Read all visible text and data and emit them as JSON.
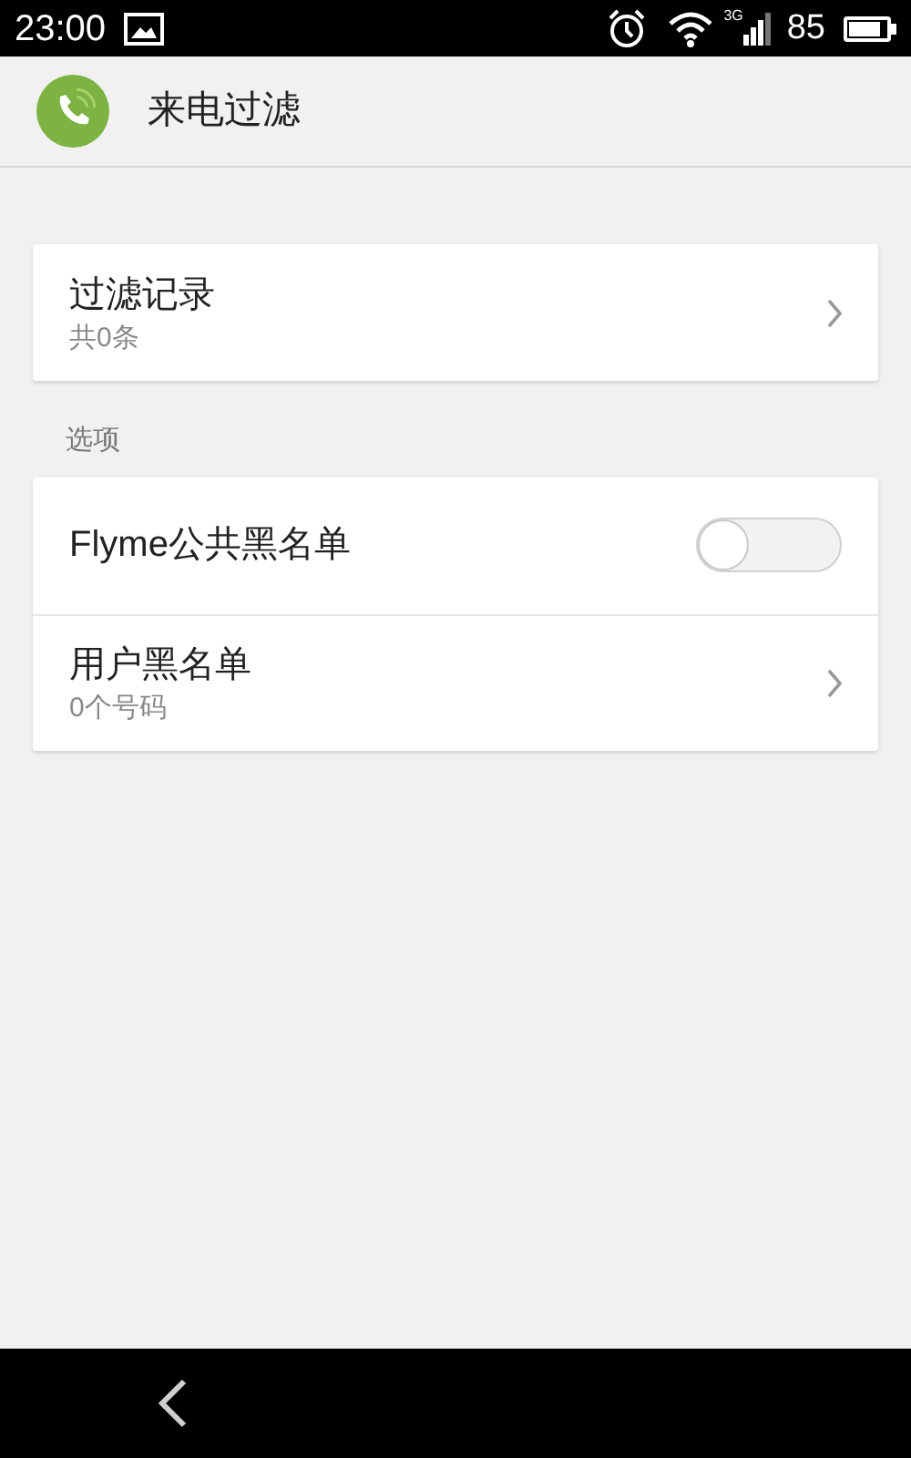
{
  "status_bar": {
    "time": "23:00",
    "network": "3G",
    "battery_text": "85"
  },
  "header": {
    "title": "来电过滤"
  },
  "groups": [
    {
      "items": [
        {
          "kind": "link",
          "title": "过滤记录",
          "subtitle": "共0条"
        }
      ]
    },
    {
      "label": "选项",
      "items": [
        {
          "kind": "toggle",
          "title": "Flyme公共黑名单",
          "on": false
        },
        {
          "kind": "link",
          "title": "用户黑名单",
          "subtitle": "0个号码"
        }
      ]
    }
  ]
}
